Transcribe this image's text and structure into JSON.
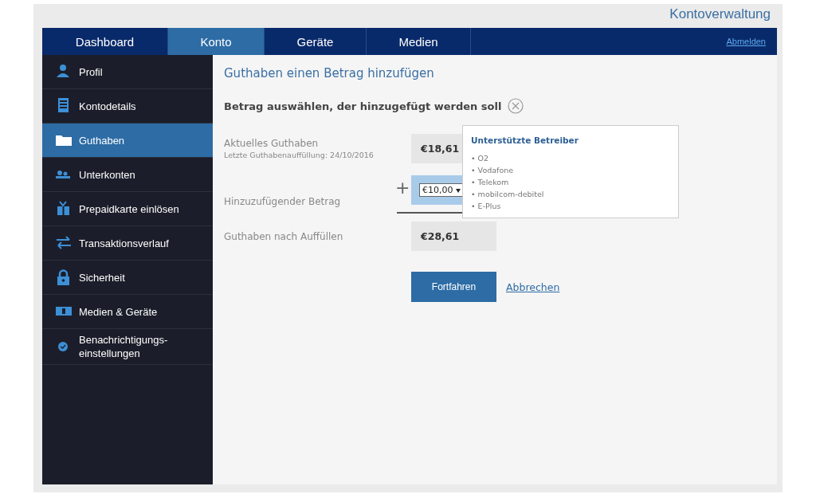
{
  "header": {
    "title": "Kontoverwaltung"
  },
  "nav": {
    "tabs": [
      {
        "label": "Dashboard",
        "selected": false
      },
      {
        "label": "Konto",
        "selected": true
      },
      {
        "label": "Geräte",
        "selected": false
      },
      {
        "label": "Medien",
        "selected": false
      }
    ],
    "logout": "Abmelden"
  },
  "sidebar": {
    "items": [
      {
        "label": "Profil",
        "selected": false
      },
      {
        "label": "Kontodetails",
        "selected": false
      },
      {
        "label": "Guthaben",
        "selected": true
      },
      {
        "label": "Unterkonten",
        "selected": false
      },
      {
        "label": "Prepaidkarte einlösen",
        "selected": false
      },
      {
        "label": "Transaktionsverlauf",
        "selected": false
      },
      {
        "label": "Sicherheit",
        "selected": false
      },
      {
        "label": "Medien & Geräte",
        "selected": false
      },
      {
        "label": "Benachrichtigungs-einstellungen",
        "selected": false
      }
    ]
  },
  "content": {
    "heading": "Guthaben einen Betrag hinzufügen",
    "instruction": "Betrag auswählen, der hinzugefügt werden soll",
    "current": {
      "label": "Aktuelles Guthaben",
      "note": "Letzte Guthabenauffüllung: 24/10/2016",
      "value": "€18,61"
    },
    "add": {
      "label": "Hinzuzufügender Betrag",
      "sign": "+",
      "value": "€10,00"
    },
    "result": {
      "label": "Guthaben nach Auffüllen",
      "value": "€28,61"
    },
    "continue_button": "Fortfahren",
    "cancel_link": "Abbrechen"
  },
  "popup": {
    "title": "Unterstützte Betreiber",
    "items": [
      "• O2",
      "• Vodafone",
      "• Telekom",
      "• mobilcom-debitel",
      "• E-Plus"
    ]
  }
}
